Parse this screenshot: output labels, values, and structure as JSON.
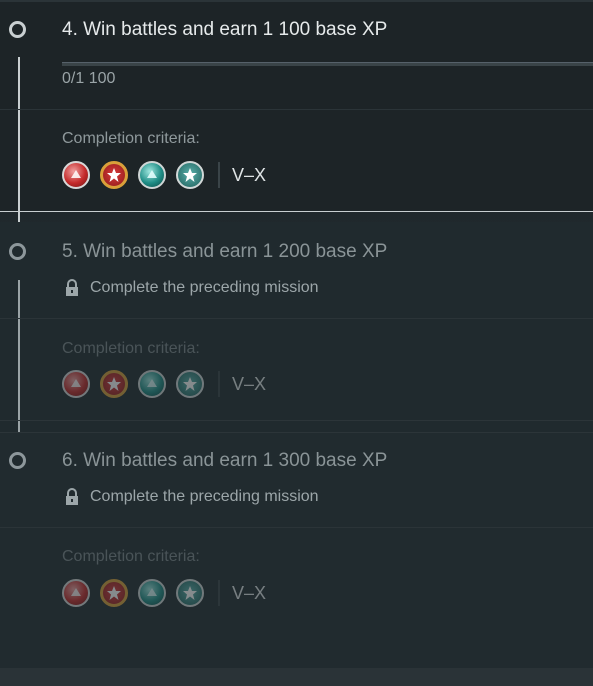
{
  "missions": [
    {
      "title": "4. Win battles and earn 1 100 base XP",
      "progress": "0/1 100",
      "progress_fraction": 0,
      "criteria_label": "Completion criteria:",
      "tier": "V–X",
      "locked": false
    },
    {
      "title": "5. Win battles and earn 1 200 base XP",
      "lock_text": "Complete the preceding mission",
      "criteria_label": "Completion criteria:",
      "tier": "V–X",
      "locked": true
    },
    {
      "title": "6. Win battles and earn 1 300 base XP",
      "lock_text": "Complete the preceding mission",
      "criteria_label": "Completion criteria:",
      "tier": "V–X",
      "locked": true
    }
  ],
  "badge_icons": [
    "destroyer-class-icon",
    "battleship-class-icon",
    "cruiser-class-icon",
    "aircraft-carrier-class-icon"
  ],
  "colors": {
    "background": "#1f272b",
    "text_active": "#e6eaeb",
    "text_dim": "#8a9497",
    "accent_red": "#c42a2a",
    "accent_teal": "#1f8d86"
  }
}
